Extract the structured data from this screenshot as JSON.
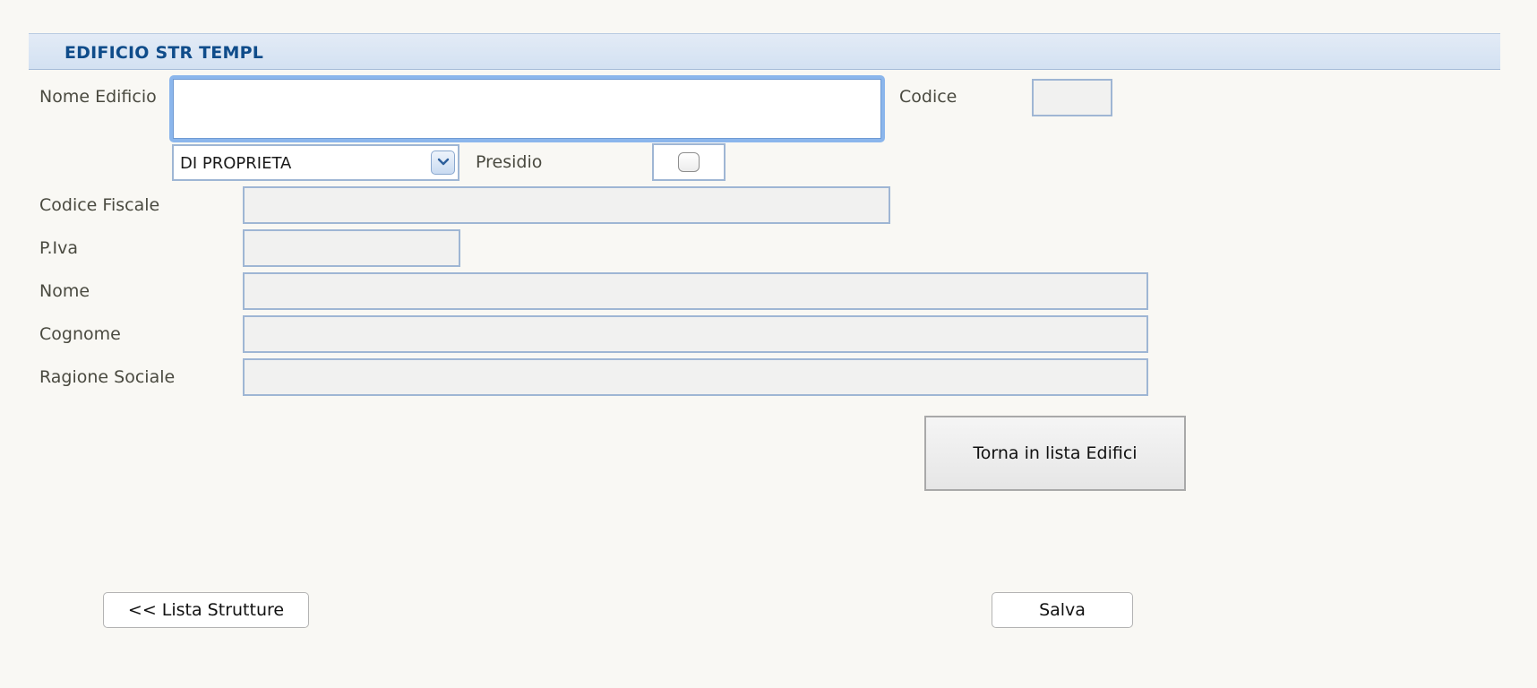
{
  "header": {
    "title": "EDIFICIO STR TEMPL"
  },
  "form": {
    "nome_edificio": {
      "label": "Nome Edificio",
      "value": ""
    },
    "codice": {
      "label": "Codice",
      "value": ""
    },
    "tipo": {
      "selected": "DI PROPRIETA"
    },
    "presidio": {
      "label": "Presidio",
      "checked": false
    },
    "codice_fiscale": {
      "label": "Codice Fiscale",
      "value": ""
    },
    "piva": {
      "label": "P.Iva",
      "value": ""
    },
    "nome": {
      "label": "Nome",
      "value": ""
    },
    "cognome": {
      "label": "Cognome",
      "value": ""
    },
    "ragione_sociale": {
      "label": "Ragione Sociale",
      "value": ""
    }
  },
  "buttons": {
    "torna_lista": "Torna in lista Edifici",
    "lista_strutture": "<< Lista Strutture",
    "salva": "Salva"
  },
  "icons": {
    "dropdown": "chevron-down-icon",
    "checkbox": "checkbox-icon"
  },
  "colors": {
    "header_text": "#0f4c8a",
    "header_bg": "#d9e5f4",
    "field_border": "#9fb6d4",
    "focus": "#8bb6ec"
  }
}
